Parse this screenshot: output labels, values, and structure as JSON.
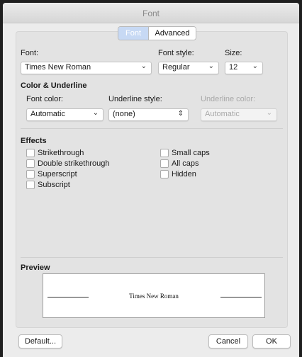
{
  "window": {
    "title": "Font"
  },
  "tabs": {
    "font": "Font",
    "advanced": "Advanced"
  },
  "font": {
    "label": "Font:",
    "value": "Times New Roman",
    "style_label": "Font style:",
    "style_value": "Regular",
    "size_label": "Size:",
    "size_value": "12"
  },
  "color_underline": {
    "heading": "Color & Underline",
    "font_color_label": "Font color:",
    "font_color_value": "Automatic",
    "underline_style_label": "Underline style:",
    "underline_style_value": "(none)",
    "underline_color_label": "Underline color:",
    "underline_color_value": "Automatic"
  },
  "effects": {
    "heading": "Effects",
    "left": [
      {
        "label": "Strikethrough",
        "checked": false
      },
      {
        "label": "Double strikethrough",
        "checked": false
      },
      {
        "label": "Superscript",
        "checked": false
      },
      {
        "label": "Subscript",
        "checked": false
      }
    ],
    "right": [
      {
        "label": "Small caps",
        "checked": false
      },
      {
        "label": "All caps",
        "checked": false
      },
      {
        "label": "Hidden",
        "checked": false
      }
    ]
  },
  "preview": {
    "heading": "Preview",
    "sample": "Times New Roman"
  },
  "buttons": {
    "default": "Default...",
    "cancel": "Cancel",
    "ok": "OK"
  },
  "colors": {
    "tab_active": "#c7d9f4",
    "window_bg": "#ececec",
    "panel_bg": "#e3e3e3"
  }
}
